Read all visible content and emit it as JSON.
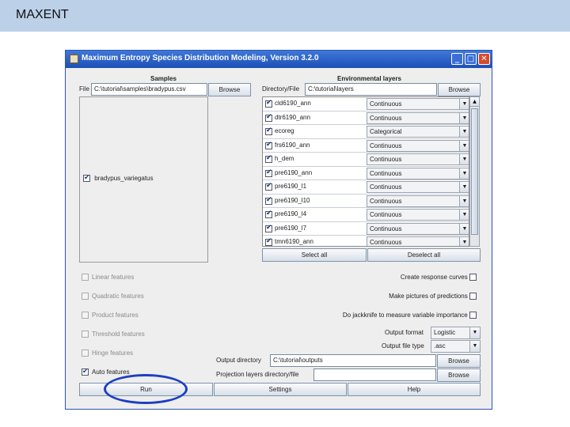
{
  "slide": {
    "title": "MAXENT"
  },
  "window": {
    "title": "Maximum Entropy Species Distribution Modeling, Version 3.2.0",
    "controls": {
      "minimize": "_",
      "maximize": "□",
      "close": "✕"
    }
  },
  "samples": {
    "heading": "Samples",
    "file_label": "File",
    "file_value": "C:\\tutorial\\samples\\bradypus.csv",
    "browse_label": "Browse",
    "species": [
      {
        "label": "bradypus_variegatus",
        "checked": true
      }
    ]
  },
  "environmental": {
    "heading": "Environmental layers",
    "dir_label": "Directory/File",
    "dir_value": "C:\\tutorial\\layers",
    "browse_label": "Browse",
    "layers": [
      {
        "name": "cld6190_ann",
        "type": "Continuous",
        "checked": true
      },
      {
        "name": "dtr6190_ann",
        "type": "Continuous",
        "checked": true
      },
      {
        "name": "ecoreg",
        "type": "Categorical",
        "checked": true
      },
      {
        "name": "frs6190_ann",
        "type": "Continuous",
        "checked": true
      },
      {
        "name": "h_dem",
        "type": "Continuous",
        "checked": true
      },
      {
        "name": "pre6190_ann",
        "type": "Continuous",
        "checked": true
      },
      {
        "name": "pre6190_l1",
        "type": "Continuous",
        "checked": true
      },
      {
        "name": "pre6190_l10",
        "type": "Continuous",
        "checked": true
      },
      {
        "name": "pre6190_l4",
        "type": "Continuous",
        "checked": true
      },
      {
        "name": "pre6190_l7",
        "type": "Continuous",
        "checked": true
      },
      {
        "name": "tmn6190_ann",
        "type": "Continuous",
        "checked": true
      }
    ],
    "select_all_label": "Select all",
    "deselect_all_label": "Deselect all"
  },
  "features": {
    "linear": {
      "label": "Linear features",
      "checked": false
    },
    "quadratic": {
      "label": "Quadratic features",
      "checked": false
    },
    "product": {
      "label": "Product features",
      "checked": false
    },
    "threshold": {
      "label": "Threshold features",
      "checked": false
    },
    "hinge": {
      "label": "Hinge features",
      "checked": false
    },
    "auto": {
      "label": "Auto features",
      "checked": true
    }
  },
  "options": {
    "response_curves": "Create response curves",
    "pictures": "Make pictures of predictions",
    "jackknife": "Do jackknife to measure variable importance",
    "output_format_label": "Output format",
    "output_format_value": "Logistic",
    "output_file_type_label": "Output file type",
    "output_file_type_value": ".asc",
    "output_dir_label": "Output directory",
    "output_dir_value": "C:\\tutorial\\outputs",
    "projection_label": "Projection layers directory/file",
    "projection_value": "",
    "browse_label": "Browse"
  },
  "actions": {
    "run": "Run",
    "settings": "Settings",
    "help": "Help"
  },
  "colors": {
    "slide_header": "#bcd0e8",
    "titlebar": "#1d4fb6",
    "highlight_ellipse": "#1b3fc4"
  }
}
